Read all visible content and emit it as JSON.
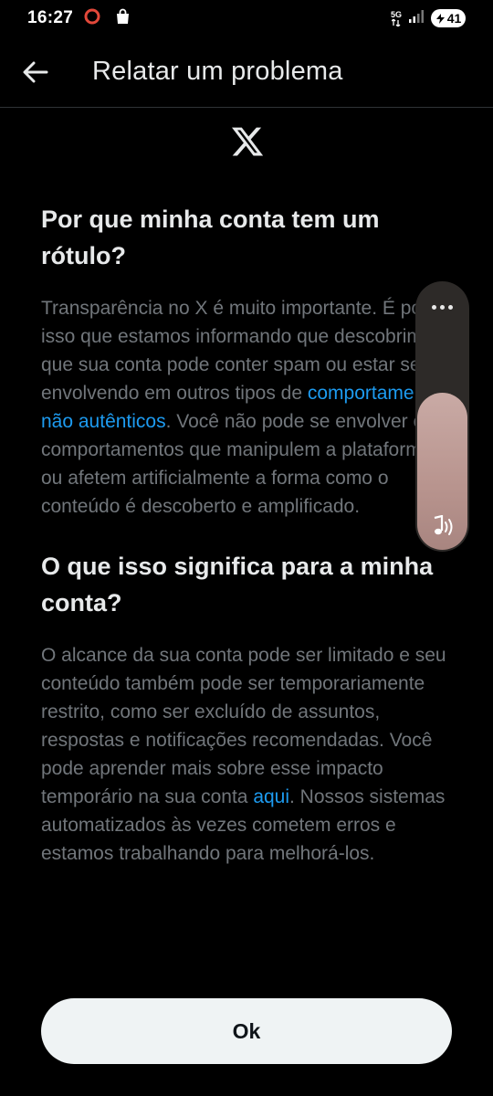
{
  "status_bar": {
    "time": "16:27",
    "network": "5G",
    "battery": "41"
  },
  "app_bar": {
    "title": "Relatar um problema"
  },
  "icons": {
    "back": "arrow-left-icon",
    "logo": "x-logo-icon",
    "notification": "circle-icon",
    "shopping": "shopping-bag-icon",
    "signal": "signal-icon",
    "battery": "battery-icon",
    "volume_more": "more-dots-icon",
    "volume_music": "music-note-icon"
  },
  "section1": {
    "heading": "Por que minha conta tem um rótulo?",
    "text_before_link": "Transparência no X é muito importante. É por isso que estamos informando que descobrimos que sua conta pode conter spam ou estar se envolvendo em outros tipos de ",
    "link": "comportamentos não autênticos",
    "text_after_link": ". Você não pode se envolver em comportamentos que manipulem a plataforma X ou afetem artificialmente a forma como o conteúdo é descoberto e amplificado."
  },
  "section2": {
    "heading": "O que isso significa para a minha conta?",
    "text_before_link": "O alcance da sua conta pode ser limitado e seu conteúdo também pode ser temporariamente restrito, como ser excluído de assuntos, respostas e notificações recomendadas. Você pode aprender mais sobre esse impacto temporário na sua conta ",
    "link": "aqui",
    "text_after_link": ". Nossos sistemas automatizados às vezes cometem erros e estamos trabalhando para melhorá-los."
  },
  "volume": {
    "level": 0.73
  },
  "ok_button": {
    "label": "Ok"
  },
  "colors": {
    "background": "#000000",
    "body_text": "#71767b",
    "heading_text": "#e7e9ea",
    "link": "#1d9bf0",
    "button_bg": "#eff3f4"
  }
}
